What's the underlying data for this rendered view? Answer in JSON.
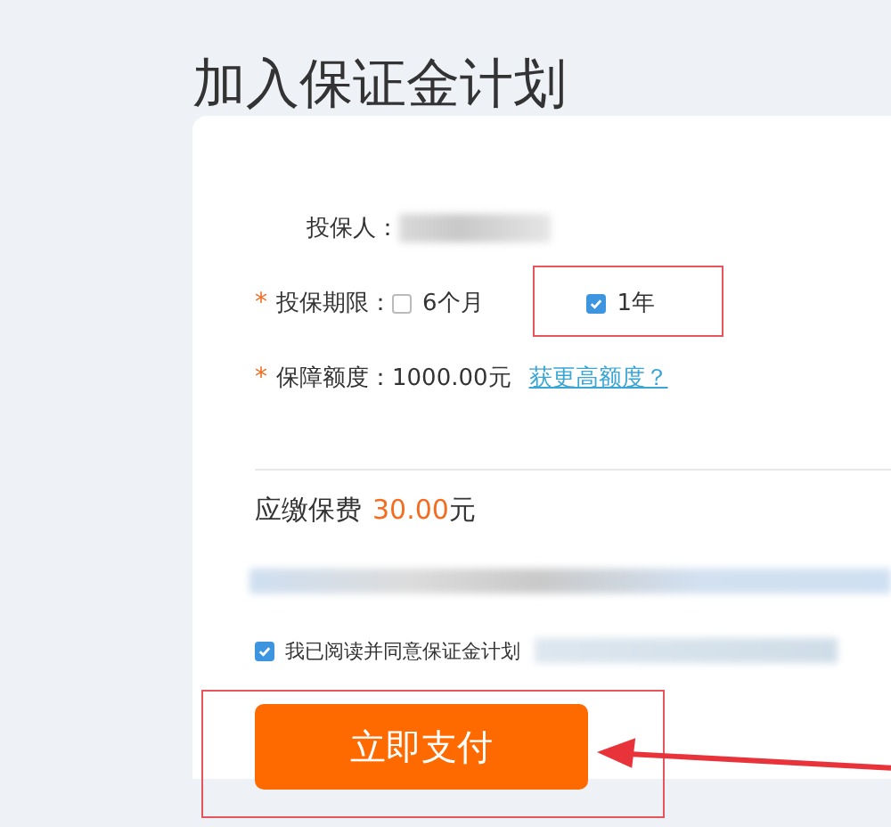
{
  "title": "加入保证金计划",
  "form": {
    "insured": {
      "label": "投保人："
    },
    "period": {
      "marker": "*",
      "label": "投保期限：",
      "options": [
        {
          "label": "6个月",
          "selected": false,
          "highlighted": false
        },
        {
          "label": "1年",
          "selected": true,
          "highlighted": true
        }
      ]
    },
    "coverage": {
      "marker": "*",
      "label": "保障额度：",
      "value": "1000.00元",
      "link": "获更高额度？"
    }
  },
  "premium": {
    "label": "应缴保费",
    "amount": "30.00",
    "unit": "元"
  },
  "agreement": {
    "text": "我已阅读并同意保证金计划",
    "checked": true
  },
  "pay_button": {
    "label": "立即支付",
    "highlighted": true
  }
}
